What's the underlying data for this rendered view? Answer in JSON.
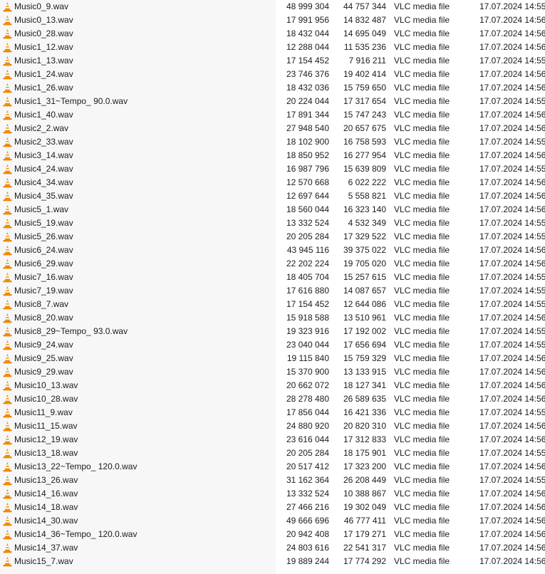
{
  "files": [
    {
      "name": "Music0_9.wav",
      "size": "48 999 304",
      "packed": "44 757 344",
      "type": "VLC media file",
      "modified": "17.07.2024 14:55"
    },
    {
      "name": "Music0_13.wav",
      "size": "17 991 956",
      "packed": "14 832 487",
      "type": "VLC media file",
      "modified": "17.07.2024 14:56"
    },
    {
      "name": "Music0_28.wav",
      "size": "18 432 044",
      "packed": "14 695 049",
      "type": "VLC media file",
      "modified": "17.07.2024 14:56"
    },
    {
      "name": "Music1_12.wav",
      "size": "12 288 044",
      "packed": "11 535 236",
      "type": "VLC media file",
      "modified": "17.07.2024 14:56"
    },
    {
      "name": "Music1_13.wav",
      "size": "17 154 452",
      "packed": "7 916 211",
      "type": "VLC media file",
      "modified": "17.07.2024 14:55"
    },
    {
      "name": "Music1_24.wav",
      "size": "23 746 376",
      "packed": "19 402 414",
      "type": "VLC media file",
      "modified": "17.07.2024 14:56"
    },
    {
      "name": "Music1_26.wav",
      "size": "18 432 036",
      "packed": "15 759 650",
      "type": "VLC media file",
      "modified": "17.07.2024 14:56"
    },
    {
      "name": "Music1_31~Tempo_ 90.0.wav",
      "size": "20 224 044",
      "packed": "17 317 654",
      "type": "VLC media file",
      "modified": "17.07.2024 14:55"
    },
    {
      "name": "Music1_40.wav",
      "size": "17 891 344",
      "packed": "15 747 243",
      "type": "VLC media file",
      "modified": "17.07.2024 14:56"
    },
    {
      "name": "Music2_2.wav",
      "size": "27 948 540",
      "packed": "20 657 675",
      "type": "VLC media file",
      "modified": "17.07.2024 14:56"
    },
    {
      "name": "Music2_33.wav",
      "size": "18 102 900",
      "packed": "16 758 593",
      "type": "VLC media file",
      "modified": "17.07.2024 14:55"
    },
    {
      "name": "Music3_14.wav",
      "size": "18 850 952",
      "packed": "16 277 954",
      "type": "VLC media file",
      "modified": "17.07.2024 14:56"
    },
    {
      "name": "Music4_24.wav",
      "size": "16 987 796",
      "packed": "15 639 809",
      "type": "VLC media file",
      "modified": "17.07.2024 14:55"
    },
    {
      "name": "Music4_34.wav",
      "size": "12 570 668",
      "packed": "6 022 222",
      "type": "VLC media file",
      "modified": "17.07.2024 14:56"
    },
    {
      "name": "Music4_35.wav",
      "size": "12 697 644",
      "packed": "5 558 821",
      "type": "VLC media file",
      "modified": "17.07.2024 14:56"
    },
    {
      "name": "Music5_1.wav",
      "size": "18 560 044",
      "packed": "16 323 140",
      "type": "VLC media file",
      "modified": "17.07.2024 14:56"
    },
    {
      "name": "Music5_19.wav",
      "size": "13 332 524",
      "packed": "4 532 349",
      "type": "VLC media file",
      "modified": "17.07.2024 14:55"
    },
    {
      "name": "Music5_26.wav",
      "size": "20 205 284",
      "packed": "17 329 522",
      "type": "VLC media file",
      "modified": "17.07.2024 14:55"
    },
    {
      "name": "Music6_24.wav",
      "size": "43 945 116",
      "packed": "39 375 022",
      "type": "VLC media file",
      "modified": "17.07.2024 14:56"
    },
    {
      "name": "Music6_29.wav",
      "size": "22 202 224",
      "packed": "19 705 020",
      "type": "VLC media file",
      "modified": "17.07.2024 14:56"
    },
    {
      "name": "Music7_16.wav",
      "size": "18 405 704",
      "packed": "15 257 615",
      "type": "VLC media file",
      "modified": "17.07.2024 14:55"
    },
    {
      "name": "Music7_19.wav",
      "size": "17 616 880",
      "packed": "14 087 657",
      "type": "VLC media file",
      "modified": "17.07.2024 14:55"
    },
    {
      "name": "Music8_7.wav",
      "size": "17 154 452",
      "packed": "12 644 086",
      "type": "VLC media file",
      "modified": "17.07.2024 14:55"
    },
    {
      "name": "Music8_20.wav",
      "size": "15 918 588",
      "packed": "13 510 961",
      "type": "VLC media file",
      "modified": "17.07.2024 14:56"
    },
    {
      "name": "Music8_29~Tempo_ 93.0.wav",
      "size": "19 323 916",
      "packed": "17 192 002",
      "type": "VLC media file",
      "modified": "17.07.2024 14:55"
    },
    {
      "name": "Music9_24.wav",
      "size": "23 040 044",
      "packed": "17 656 694",
      "type": "VLC media file",
      "modified": "17.07.2024 14:55"
    },
    {
      "name": "Music9_25.wav",
      "size": "19 115 840",
      "packed": "15 759 329",
      "type": "VLC media file",
      "modified": "17.07.2024 14:56"
    },
    {
      "name": "Music9_29.wav",
      "size": "15 370 900",
      "packed": "13 133 915",
      "type": "VLC media file",
      "modified": "17.07.2024 14:56"
    },
    {
      "name": "Music10_13.wav",
      "size": "20 662 072",
      "packed": "18 127 341",
      "type": "VLC media file",
      "modified": "17.07.2024 14:56"
    },
    {
      "name": "Music10_28.wav",
      "size": "28 278 480",
      "packed": "26 589 635",
      "type": "VLC media file",
      "modified": "17.07.2024 14:56"
    },
    {
      "name": "Music11_9.wav",
      "size": "17 856 044",
      "packed": "16 421 336",
      "type": "VLC media file",
      "modified": "17.07.2024 14:55"
    },
    {
      "name": "Music11_15.wav",
      "size": "24 880 920",
      "packed": "20 820 310",
      "type": "VLC media file",
      "modified": "17.07.2024 14:56"
    },
    {
      "name": "Music12_19.wav",
      "size": "23 616 044",
      "packed": "17 312 833",
      "type": "VLC media file",
      "modified": "17.07.2024 14:56"
    },
    {
      "name": "Music13_18.wav",
      "size": "20 205 284",
      "packed": "18 175 901",
      "type": "VLC media file",
      "modified": "17.07.2024 14:55"
    },
    {
      "name": "Music13_22~Tempo_ 120.0.wav",
      "size": "20 517 412",
      "packed": "17 323 200",
      "type": "VLC media file",
      "modified": "17.07.2024 14:56"
    },
    {
      "name": "Music13_26.wav",
      "size": "31 162 364",
      "packed": "26 208 449",
      "type": "VLC media file",
      "modified": "17.07.2024 14:55"
    },
    {
      "name": "Music14_16.wav",
      "size": "13 332 524",
      "packed": "10 388 867",
      "type": "VLC media file",
      "modified": "17.07.2024 14:56"
    },
    {
      "name": "Music14_18.wav",
      "size": "27 466 216",
      "packed": "19 302 049",
      "type": "VLC media file",
      "modified": "17.07.2024 14:56"
    },
    {
      "name": "Music14_30.wav",
      "size": "49 666 696",
      "packed": "46 777 411",
      "type": "VLC media file",
      "modified": "17.07.2024 14:56"
    },
    {
      "name": "Music14_36~Tempo_ 120.0.wav",
      "size": "20 942 408",
      "packed": "17 179 271",
      "type": "VLC media file",
      "modified": "17.07.2024 14:56"
    },
    {
      "name": "Music14_37.wav",
      "size": "24 803 616",
      "packed": "22 541 317",
      "type": "VLC media file",
      "modified": "17.07.2024 14:56"
    },
    {
      "name": "Music15_7.wav",
      "size": "19 889 244",
      "packed": "17 774 292",
      "type": "VLC media file",
      "modified": "17.07.2024 14:56"
    }
  ],
  "icon": "vlc-cone-icon",
  "colors": {
    "cone_orange": "#f08a00",
    "cone_stripe": "#ffffff",
    "name_column_shade": "#f7f7f7"
  }
}
